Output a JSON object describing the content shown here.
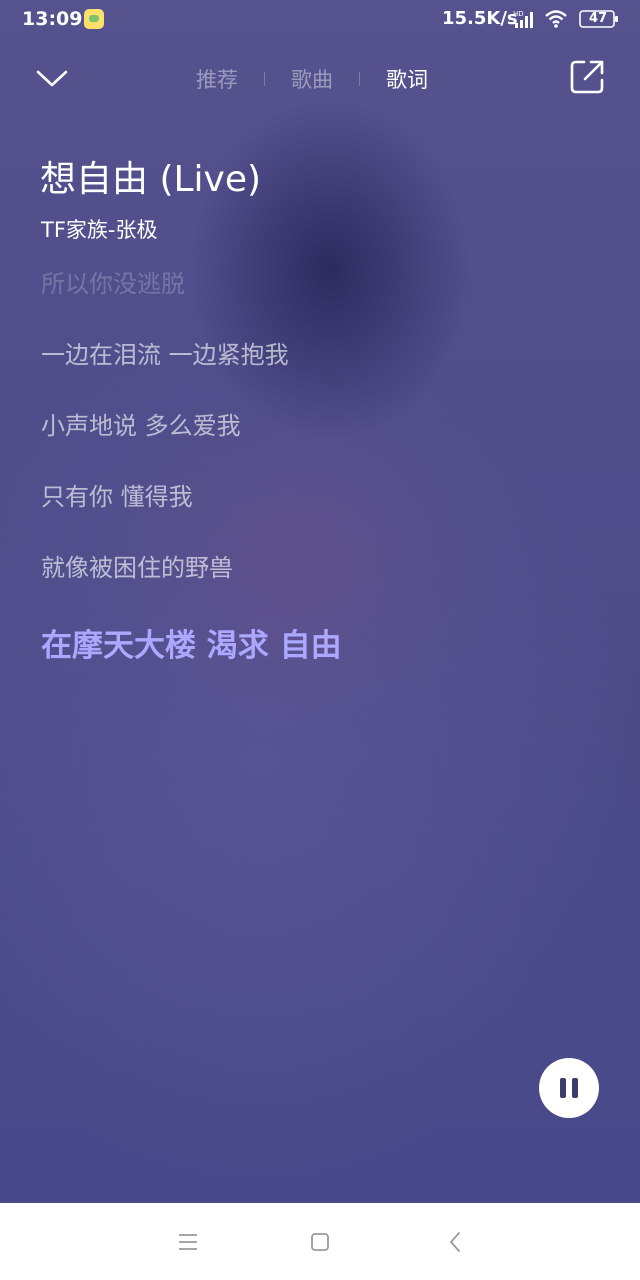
{
  "status_bar": {
    "time": "13:09",
    "network_speed": "15.5K/s",
    "signal_label": "HD",
    "battery": "47"
  },
  "nav": {
    "tabs": [
      {
        "label": "推荐",
        "active": false
      },
      {
        "label": "歌曲",
        "active": false
      },
      {
        "label": "歌词",
        "active": true
      }
    ]
  },
  "song": {
    "title": "想自由 (Live)",
    "artist": "TF家族-张极"
  },
  "lyrics": {
    "lines": [
      "所以你没逃脱",
      "一边在泪流 一边紧抱我",
      "小声地说 多么爱我",
      "只有你 懂得我",
      "就像被困住的野兽",
      "在摩天大楼 渴求 自由"
    ],
    "current_index": 5
  },
  "colors": {
    "background": "#4e4c88",
    "current_lyric": "#aca8ff",
    "lyric": "#d8d6ec"
  }
}
